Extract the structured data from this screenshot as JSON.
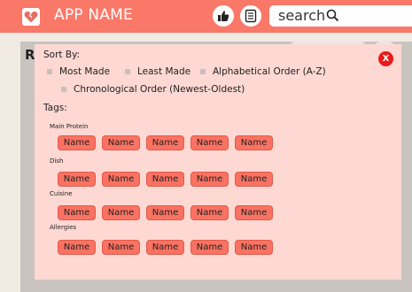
{
  "header": {
    "app_name": "APP NAME",
    "like_icon": "thumbs-up-icon",
    "list_icon": "list-icon",
    "search_text": "search",
    "search_icon": "search-icon",
    "accent_color": "#fa7868"
  },
  "page": {
    "heading_initial": "R"
  },
  "filter_modal": {
    "close_label": "X",
    "sort_by_label": "Sort By:",
    "sort_options": [
      "Most Made",
      "Least Made",
      "Alphabetical Order (A-Z)",
      "Chronological Order (Newest-Oldest)"
    ],
    "tags_label": "Tags:",
    "tag_groups": [
      {
        "label": "Main Protein",
        "tags": [
          "Name",
          "Name",
          "Name",
          "Name",
          "Name"
        ]
      },
      {
        "label": "Dish",
        "tags": [
          "Name",
          "Name",
          "Name",
          "Name",
          "Name"
        ]
      },
      {
        "label": "Cuisine",
        "tags": [
          "Name",
          "Name",
          "Name",
          "Name",
          "Name"
        ]
      },
      {
        "label": "Allergies",
        "tags": [
          "Name",
          "Name",
          "Name",
          "Name",
          "Name"
        ]
      }
    ]
  }
}
